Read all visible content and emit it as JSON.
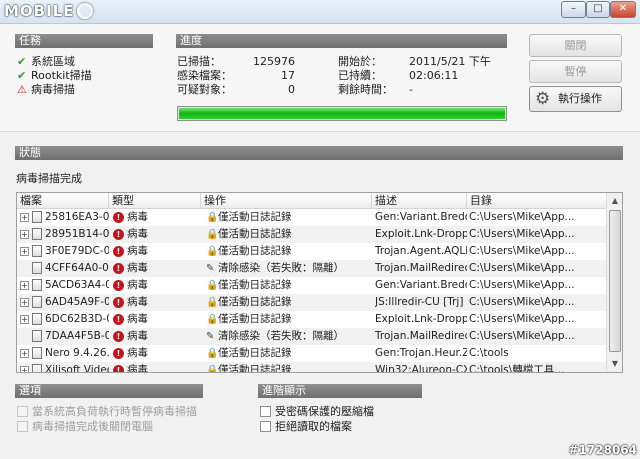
{
  "window": {
    "logo_text": "MOBILE",
    "minimize": "–",
    "maximize": "□",
    "close": "✕"
  },
  "tasks": {
    "header": "任務",
    "items": [
      {
        "label": "系統區域",
        "state": "ok",
        "icon": "check-icon"
      },
      {
        "label": "Rootkit掃描",
        "state": "ok",
        "icon": "check-icon"
      },
      {
        "label": "病毒掃描",
        "state": "warning",
        "icon": "warning-icon"
      }
    ]
  },
  "progress": {
    "header": "進度",
    "scanned_label": "已掃描：",
    "scanned_value": "125976",
    "infected_label": "感染檔案：",
    "infected_value": "17",
    "suspicious_label": "可疑對象：",
    "suspicious_value": "0",
    "start_label": "開始於：",
    "start_value": "2011/5/21 下午",
    "elapsed_label": "已持續：",
    "elapsed_value": "02:06:11",
    "remaining_label": "剩餘時間：",
    "remaining_value": "-",
    "percent": 100,
    "bar_color": "#0fb40f"
  },
  "buttons": {
    "close": "關閉",
    "pause": "暫停",
    "action": "執行操作",
    "action_icon": "gear-icon"
  },
  "status": {
    "header": "狀態",
    "message": "病毒掃描完成"
  },
  "table": {
    "columns": [
      "檔案",
      "類型",
      "操作",
      "描述",
      "目錄"
    ],
    "rows": [
      {
        "expandable": true,
        "file": "25816EA3-0...",
        "type": "病毒",
        "action": "僅活動日誌記錄",
        "action_icon": "log-icon",
        "desc": "Gen:Variant.Bredo...",
        "dir": "C:\\Users\\Mike\\App..."
      },
      {
        "expandable": true,
        "file": "28951B14-0...",
        "type": "病毒",
        "action": "僅活動日誌記錄",
        "action_icon": "log-icon",
        "desc": "Exploit.Lnk-Droppe...",
        "dir": "C:\\Users\\Mike\\App..."
      },
      {
        "expandable": true,
        "file": "3F0E79DC-0...",
        "type": "病毒",
        "action": "僅活動日誌記錄",
        "action_icon": "log-icon",
        "desc": "Trojan.Agent.AQLL...",
        "dir": "C:\\Users\\Mike\\App..."
      },
      {
        "expandable": false,
        "file": "4CFF64A0-0...",
        "type": "病毒",
        "action": "清除感染（若失敗：隔離）",
        "action_icon": "clean-icon",
        "desc": "Trojan.MailRedirec...",
        "dir": "C:\\Users\\Mike\\App..."
      },
      {
        "expandable": true,
        "file": "5ACD63A4-0...",
        "type": "病毒",
        "action": "僅活動日誌記錄",
        "action_icon": "log-icon",
        "desc": "Gen:Variant.Bredo...",
        "dir": "C:\\Users\\Mike\\App..."
      },
      {
        "expandable": true,
        "file": "6AD45A9F-0...",
        "type": "病毒",
        "action": "僅活動日誌記錄",
        "action_icon": "log-icon",
        "desc": "JS:Illredir-CU [Trj] (...",
        "dir": "C:\\Users\\Mike\\App..."
      },
      {
        "expandable": true,
        "file": "6DC62B3D-0...",
        "type": "病毒",
        "action": "僅活動日誌記錄",
        "action_icon": "log-icon",
        "desc": "Exploit.Lnk-Droppe...",
        "dir": "C:\\Users\\Mike\\App..."
      },
      {
        "expandable": false,
        "file": "7DAA4F5B-0...",
        "type": "病毒",
        "action": "清除感染（若失敗：隔離）",
        "action_icon": "clean-icon",
        "desc": "Trojan.MailRedirec...",
        "dir": "C:\\Users\\Mike\\App..."
      },
      {
        "expandable": true,
        "file": "Nero 9.4.26.0...",
        "type": "病毒",
        "action": "僅活動日誌記錄",
        "action_icon": "log-icon",
        "desc": "Gen:Trojan.Heur.Z...",
        "dir": "C:\\tools"
      },
      {
        "expandable": true,
        "file": "Xilisoft Video...",
        "type": "病毒",
        "action": "僅活動日誌記錄",
        "action_icon": "log-icon",
        "desc": "Win32:Alureon-CX...",
        "dir": "C:\\tools\\轉檔工具..."
      }
    ]
  },
  "options": {
    "header": "選項",
    "items": [
      {
        "label": "當系統高負荷執行時暫停病毒掃描",
        "checked": false,
        "disabled": true
      },
      {
        "label": "病毒掃描完成後關閉電腦",
        "checked": false,
        "disabled": true
      }
    ]
  },
  "advanced": {
    "header": "進階顯示",
    "items": [
      {
        "label": "受密碼保護的壓縮檔",
        "checked": false,
        "disabled": false
      },
      {
        "label": "拒絕讀取的檔案",
        "checked": false,
        "disabled": false
      }
    ]
  },
  "watermark": "#1728064"
}
